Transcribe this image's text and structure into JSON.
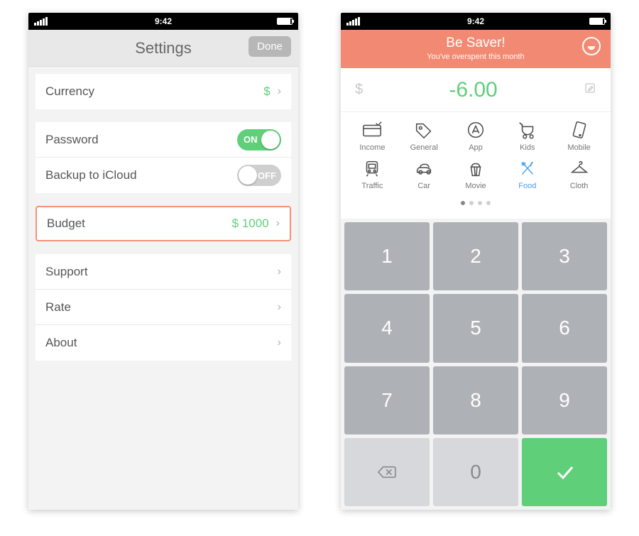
{
  "status": {
    "time": "9:42"
  },
  "settings": {
    "title": "Settings",
    "done": "Done",
    "rows": {
      "currency": {
        "label": "Currency",
        "value": "$"
      },
      "password": {
        "label": "Password",
        "toggle": "ON",
        "on": true
      },
      "backup": {
        "label": "Backup to iCloud",
        "toggle": "OFF",
        "on": false
      },
      "budget": {
        "label": "Budget",
        "value": "$ 1000"
      },
      "support": {
        "label": "Support"
      },
      "rate": {
        "label": "Rate"
      },
      "about": {
        "label": "About"
      }
    }
  },
  "entry": {
    "header": {
      "title": "Be Saver!",
      "subtitle": "You've overspent this month"
    },
    "currency_symbol": "$",
    "amount": "-6.00",
    "categories": [
      {
        "id": "income",
        "label": "Income"
      },
      {
        "id": "general",
        "label": "General"
      },
      {
        "id": "app",
        "label": "App"
      },
      {
        "id": "kids",
        "label": "Kids"
      },
      {
        "id": "mobile",
        "label": "Mobile"
      },
      {
        "id": "traffic",
        "label": "Traffic"
      },
      {
        "id": "car",
        "label": "Car"
      },
      {
        "id": "movie",
        "label": "Movie"
      },
      {
        "id": "food",
        "label": "Food",
        "selected": true
      },
      {
        "id": "cloth",
        "label": "Cloth"
      }
    ],
    "keypad": {
      "k1": "1",
      "k2": "2",
      "k3": "3",
      "k4": "4",
      "k5": "5",
      "k6": "6",
      "k7": "7",
      "k8": "8",
      "k9": "9",
      "k0": "0"
    }
  }
}
